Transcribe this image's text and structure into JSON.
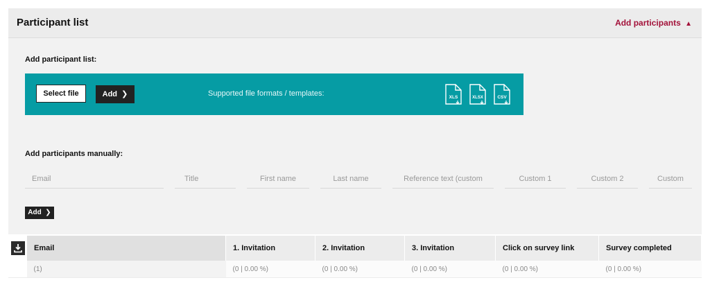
{
  "panel": {
    "title": "Participant list",
    "toggle_label": "Add participants",
    "toggle_icon": "chevron-up-icon",
    "accent_color": "#a3123a"
  },
  "upload": {
    "section_label": "Add participant list:",
    "select_file_label": "Select file",
    "add_label": "Add",
    "formats_text": "Supported file formats / templates:",
    "bar_color": "#069ca4",
    "templates": [
      "XLS",
      "XLSX",
      "CSV"
    ]
  },
  "manual": {
    "section_label": "Add participants manually:",
    "fields": [
      {
        "placeholder": "Email"
      },
      {
        "placeholder": "Title"
      },
      {
        "placeholder": "First name"
      },
      {
        "placeholder": "Last name"
      },
      {
        "placeholder": "Reference text (custom"
      },
      {
        "placeholder": "Custom 1"
      },
      {
        "placeholder": "Custom 2"
      },
      {
        "placeholder": "Custom"
      }
    ],
    "add_label": "Add"
  },
  "table": {
    "columns": [
      "Email",
      "1. Invitation",
      "2. Invitation",
      "3. Invitation",
      "Click on survey link",
      "Survey completed"
    ],
    "summary_row": [
      "(1)",
      "(0 | 0.00 %)",
      "(0 | 0.00 %)",
      "(0 | 0.00 %)",
      "(0 | 0.00 %)",
      "(0 | 0.00 %)"
    ]
  }
}
